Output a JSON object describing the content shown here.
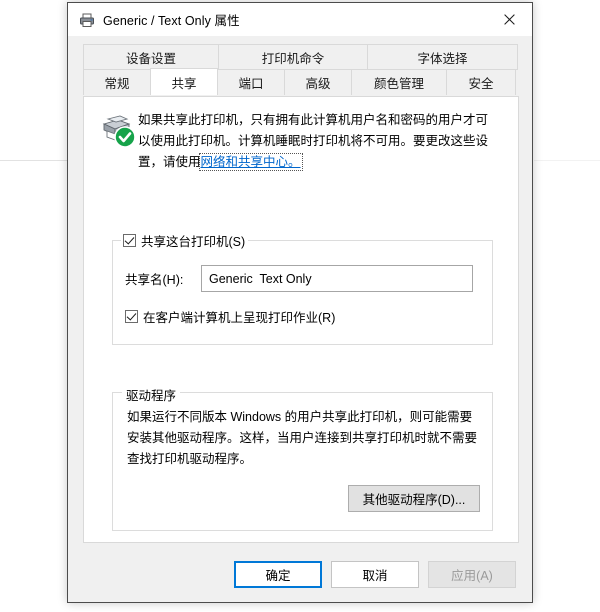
{
  "window": {
    "title": "Generic / Text Only 属性",
    "icon": "printer-icon",
    "close_label": "✕"
  },
  "tabs": {
    "top_row": [
      {
        "label": "设备设置",
        "selected": false
      },
      {
        "label": "打印机命令",
        "selected": false
      },
      {
        "label": "字体选择",
        "selected": false
      }
    ],
    "bottom_row": [
      {
        "label": "常规",
        "selected": false
      },
      {
        "label": "共享",
        "selected": true
      },
      {
        "label": "端口",
        "selected": false
      },
      {
        "label": "高级",
        "selected": false
      },
      {
        "label": "颜色管理",
        "selected": false
      },
      {
        "label": "安全",
        "selected": false
      }
    ]
  },
  "info": {
    "icon": "printer-shared-ok-icon",
    "text_before_link": "如果共享此打印机，只有拥有此计算机用户名和密码的用户才可以使用此打印机。计算机睡眠时打印机将不可用。要更改这些设置，请使用",
    "link_text": "网络和共享中心。"
  },
  "share_group": {
    "checkbox_label": "共享这台打印机(S)",
    "checkbox_accel": "S",
    "checked": true,
    "share_name_label": "共享名(H):",
    "share_name_accel": "H",
    "share_name_value": "Generic  Text Only",
    "render_jobs_label": "在客户端计算机上呈现打印作业(R)",
    "render_jobs_accel": "R",
    "render_jobs_checked": true
  },
  "driver_group": {
    "title": "驱动程序",
    "description": "如果运行不同版本 Windows 的用户共享此打印机，则可能需要安装其他驱动程序。这样，当用户连接到共享打印机时就不需要查找打印机驱动程序。",
    "button_label": "其他驱动程序(D)...",
    "button_accel": "D"
  },
  "footer": {
    "ok_label": "确定",
    "cancel_label": "取消",
    "apply_label": "应用(A)",
    "apply_accel": "A",
    "apply_disabled": true
  },
  "colors": {
    "accent": "#0078d7",
    "link": "#0066cc",
    "status_ok": "#16a34a",
    "dialog_bg": "#f0f0f0",
    "panel_bg": "#ffffff"
  }
}
